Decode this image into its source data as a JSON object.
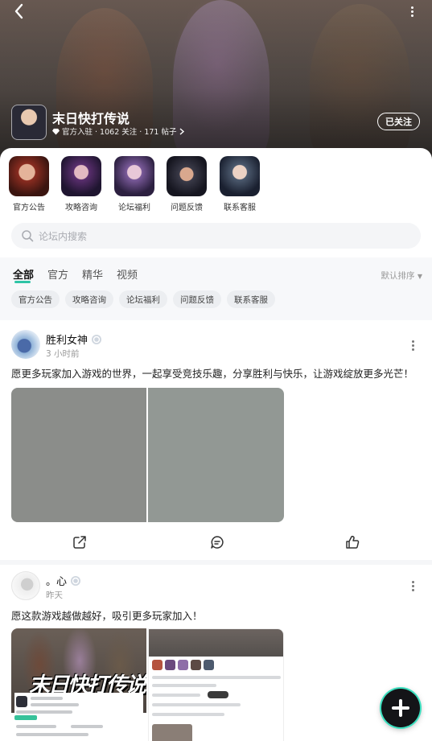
{
  "header": {
    "forum_name": "末日快打传说",
    "meta": "官方入驻 · 1062 关注 · 171 帖子",
    "follow_label": "已关注"
  },
  "quick_links": [
    {
      "label": "官方公告"
    },
    {
      "label": "攻略咨询"
    },
    {
      "label": "论坛福利"
    },
    {
      "label": "问题反馈"
    },
    {
      "label": "联系客服"
    }
  ],
  "search": {
    "placeholder": "论坛内搜索"
  },
  "tabs": [
    {
      "label": "全部",
      "active": true
    },
    {
      "label": "官方",
      "active": false
    },
    {
      "label": "精华",
      "active": false
    },
    {
      "label": "视频",
      "active": false
    }
  ],
  "sort_label": "默认排序",
  "chips": [
    {
      "label": "官方公告"
    },
    {
      "label": "攻略咨询"
    },
    {
      "label": "论坛福利"
    },
    {
      "label": "问题反馈"
    },
    {
      "label": "联系客服"
    }
  ],
  "posts": [
    {
      "author": "胜利女神",
      "time": "3 小时前",
      "text": "愿更多玩家加入游戏的世界，一起享受竞技乐趣，分享胜利与快乐，让游戏绽放更多光芒！"
    },
    {
      "author": "。心",
      "time": "昨天",
      "text": "愿这款游戏越做越好，吸引更多玩家加入！",
      "screenshot_title": "末日快打传说"
    }
  ],
  "colors": {
    "accent": "#2fc4a6",
    "chip_bg": "#eceef1",
    "search_bg": "#f4f5f7"
  },
  "icons": [
    "back-icon",
    "more-icon",
    "diamond-icon",
    "search-icon",
    "verified-icon",
    "share-icon",
    "comment-icon",
    "like-icon",
    "plus-icon"
  ]
}
